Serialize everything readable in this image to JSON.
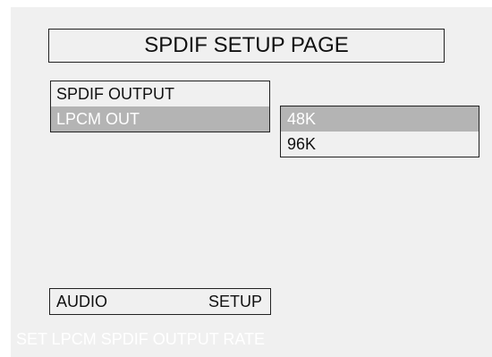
{
  "page_title": "SPDIF SETUP PAGE",
  "menu": {
    "items": [
      {
        "label": "SPDIF OUTPUT",
        "selected": false
      },
      {
        "label": "LPCM OUT",
        "selected": true
      }
    ]
  },
  "submenu": {
    "items": [
      {
        "label": "48K",
        "selected": true
      },
      {
        "label": "96K",
        "selected": false
      }
    ]
  },
  "bottom_nav": {
    "left_label": "AUDIO",
    "right_label": "SETUP"
  },
  "status": {
    "text": "SET LPCM SPDIF OUTPUT RATE"
  },
  "colors": {
    "screen_background": "#f0f0f0",
    "highlight": "#b4b4b4",
    "border": "#222222",
    "text": "#111111",
    "highlight_text": "#ffffff"
  }
}
